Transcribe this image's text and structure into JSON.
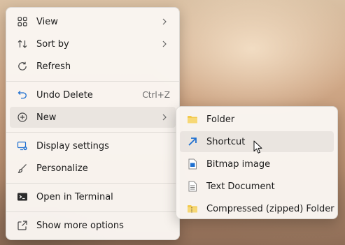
{
  "context_menu": {
    "items": [
      {
        "label": "View",
        "icon": "grid-icon",
        "submenu": true
      },
      {
        "label": "Sort by",
        "icon": "sort-icon",
        "submenu": true
      },
      {
        "label": "Refresh",
        "icon": "refresh-icon"
      },
      {
        "label": "Undo Delete",
        "icon": "undo-icon",
        "shortcut": "Ctrl+Z"
      },
      {
        "label": "New",
        "icon": "plus-circle-icon",
        "submenu": true
      },
      {
        "label": "Display settings",
        "icon": "display-icon"
      },
      {
        "label": "Personalize",
        "icon": "brush-icon"
      },
      {
        "label": "Open in Terminal",
        "icon": "terminal-icon"
      },
      {
        "label": "Show more options",
        "icon": "share-icon"
      }
    ]
  },
  "new_submenu": {
    "items": [
      {
        "label": "Folder",
        "icon": "folder-icon"
      },
      {
        "label": "Shortcut",
        "icon": "shortcut-arrow-icon"
      },
      {
        "label": "Bitmap image",
        "icon": "bitmap-icon"
      },
      {
        "label": "Text Document",
        "icon": "text-document-icon"
      },
      {
        "label": "Compressed (zipped) Folder",
        "icon": "zip-folder-icon"
      }
    ]
  },
  "colors": {
    "menu_background": "#faf6f2",
    "accent_blue": "#1e6fd0",
    "folder_yellow": "#f2c94c"
  }
}
